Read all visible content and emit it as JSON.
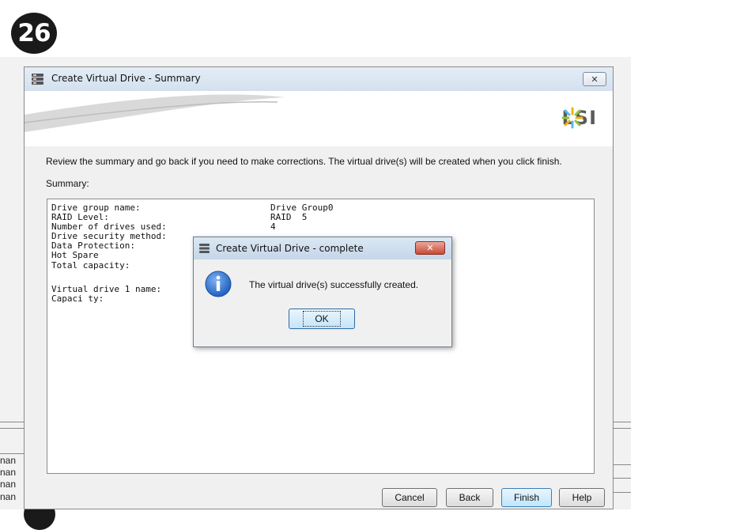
{
  "step_number": "26",
  "background": {
    "row_fragments": [
      "nan",
      "nan",
      "nan",
      "nan"
    ]
  },
  "window": {
    "title": "Create Virtual Drive - Summary",
    "close_label": "✕",
    "logo_text": "LSI",
    "instructions": "Review the summary and go back if you need to make corrections. The virtual drive(s) will be created when you click finish.",
    "summary_label": "Summary:",
    "summary_rows": [
      {
        "label": "Drive group name:",
        "value": "Drive Group0"
      },
      {
        "label": "RAID Level:",
        "value": "RAID  5"
      },
      {
        "label": "Number of drives used:",
        "value": "4"
      },
      {
        "label": "Drive security method:",
        "value": ""
      },
      {
        "label": "Data Protection:",
        "value": ""
      },
      {
        "label": "Hot Spare",
        "value": ""
      },
      {
        "label": "Total capacity:",
        "value": ""
      },
      {
        "label": "Virtual drive 1 name:",
        "value": ""
      },
      {
        "label": "Capaci ty:",
        "value": ""
      }
    ],
    "buttons": {
      "cancel": "Cancel",
      "back": "Back",
      "finish": "Finish",
      "help": "Help"
    }
  },
  "dialog": {
    "title": "Create Virtual Drive - complete",
    "close_label": "✕",
    "message": "The virtual drive(s) successfully created.",
    "ok_label": "OK"
  },
  "colors": {
    "accent": "#3c7fb1",
    "info_icon": "#1f5fbf",
    "dialog_close": "#c74a36"
  }
}
